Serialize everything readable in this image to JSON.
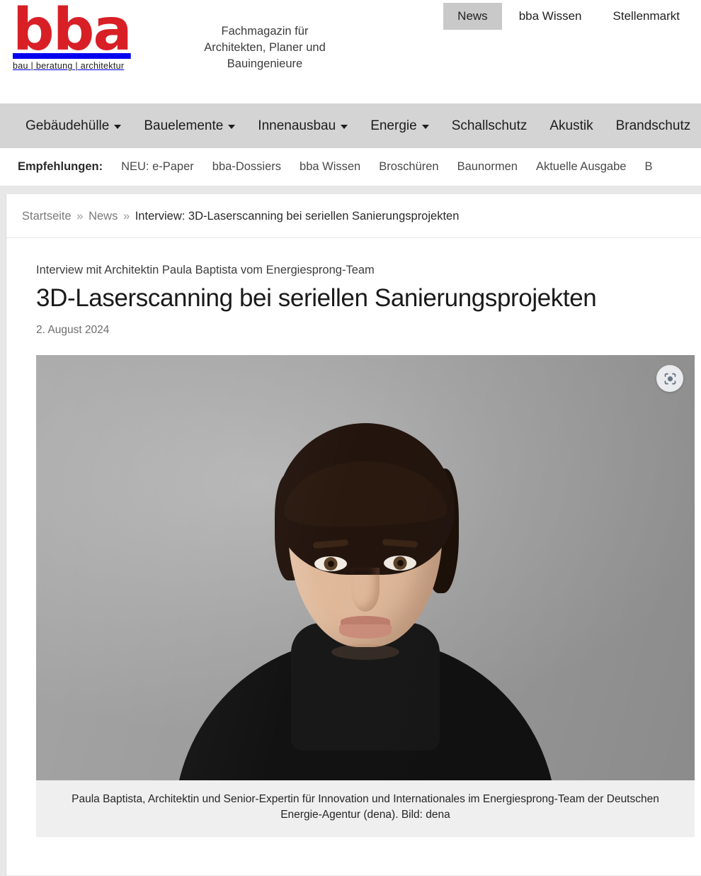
{
  "header": {
    "logo": {
      "mark": "bba",
      "subtitle": "bau | beratung | architektur",
      "brand_color": "#d81f26"
    },
    "tagline": "Fachmagazin für Architekten, Planer und Bauingenieure",
    "top_nav": [
      {
        "label": "News",
        "active": true
      },
      {
        "label": "bba Wissen",
        "active": false
      },
      {
        "label": "Stellenmarkt",
        "active": false
      }
    ]
  },
  "main_nav": [
    {
      "label": "Gebäudehülle",
      "has_dropdown": true
    },
    {
      "label": "Bauelemente",
      "has_dropdown": true
    },
    {
      "label": "Innenausbau",
      "has_dropdown": true
    },
    {
      "label": "Energie",
      "has_dropdown": true
    },
    {
      "label": "Schallschutz",
      "has_dropdown": false
    },
    {
      "label": "Akustik",
      "has_dropdown": false
    },
    {
      "label": "Brandschutz",
      "has_dropdown": false
    }
  ],
  "recommendations": {
    "label": "Empfehlungen:",
    "items": [
      "NEU: e-Paper",
      "bba-Dossiers",
      "bba Wissen",
      "Broschüren",
      "Baunormen",
      "Aktuelle Ausgabe",
      "B"
    ]
  },
  "breadcrumb": {
    "home": "Startseite",
    "section": "News",
    "current": "Interview: 3D-Laserscanning bei seriellen Sanierungsprojekten",
    "separator": "»"
  },
  "article": {
    "kicker": "Interview mit Architektin Paula Baptista vom Energiesprong-Team",
    "headline": "3D-Laserscanning bei seriellen Sanierungsprojekten",
    "date": "2. August 2024",
    "figure": {
      "caption": "Paula Baptista, Architektin und Senior-Expertin für Innovation und Internationales im Energiesprong-Team der Deutschen Energie-Agentur (dena). Bild: dena",
      "lens_icon": "google-lens-icon",
      "alt": "Portraitfoto Paula Baptista"
    }
  }
}
